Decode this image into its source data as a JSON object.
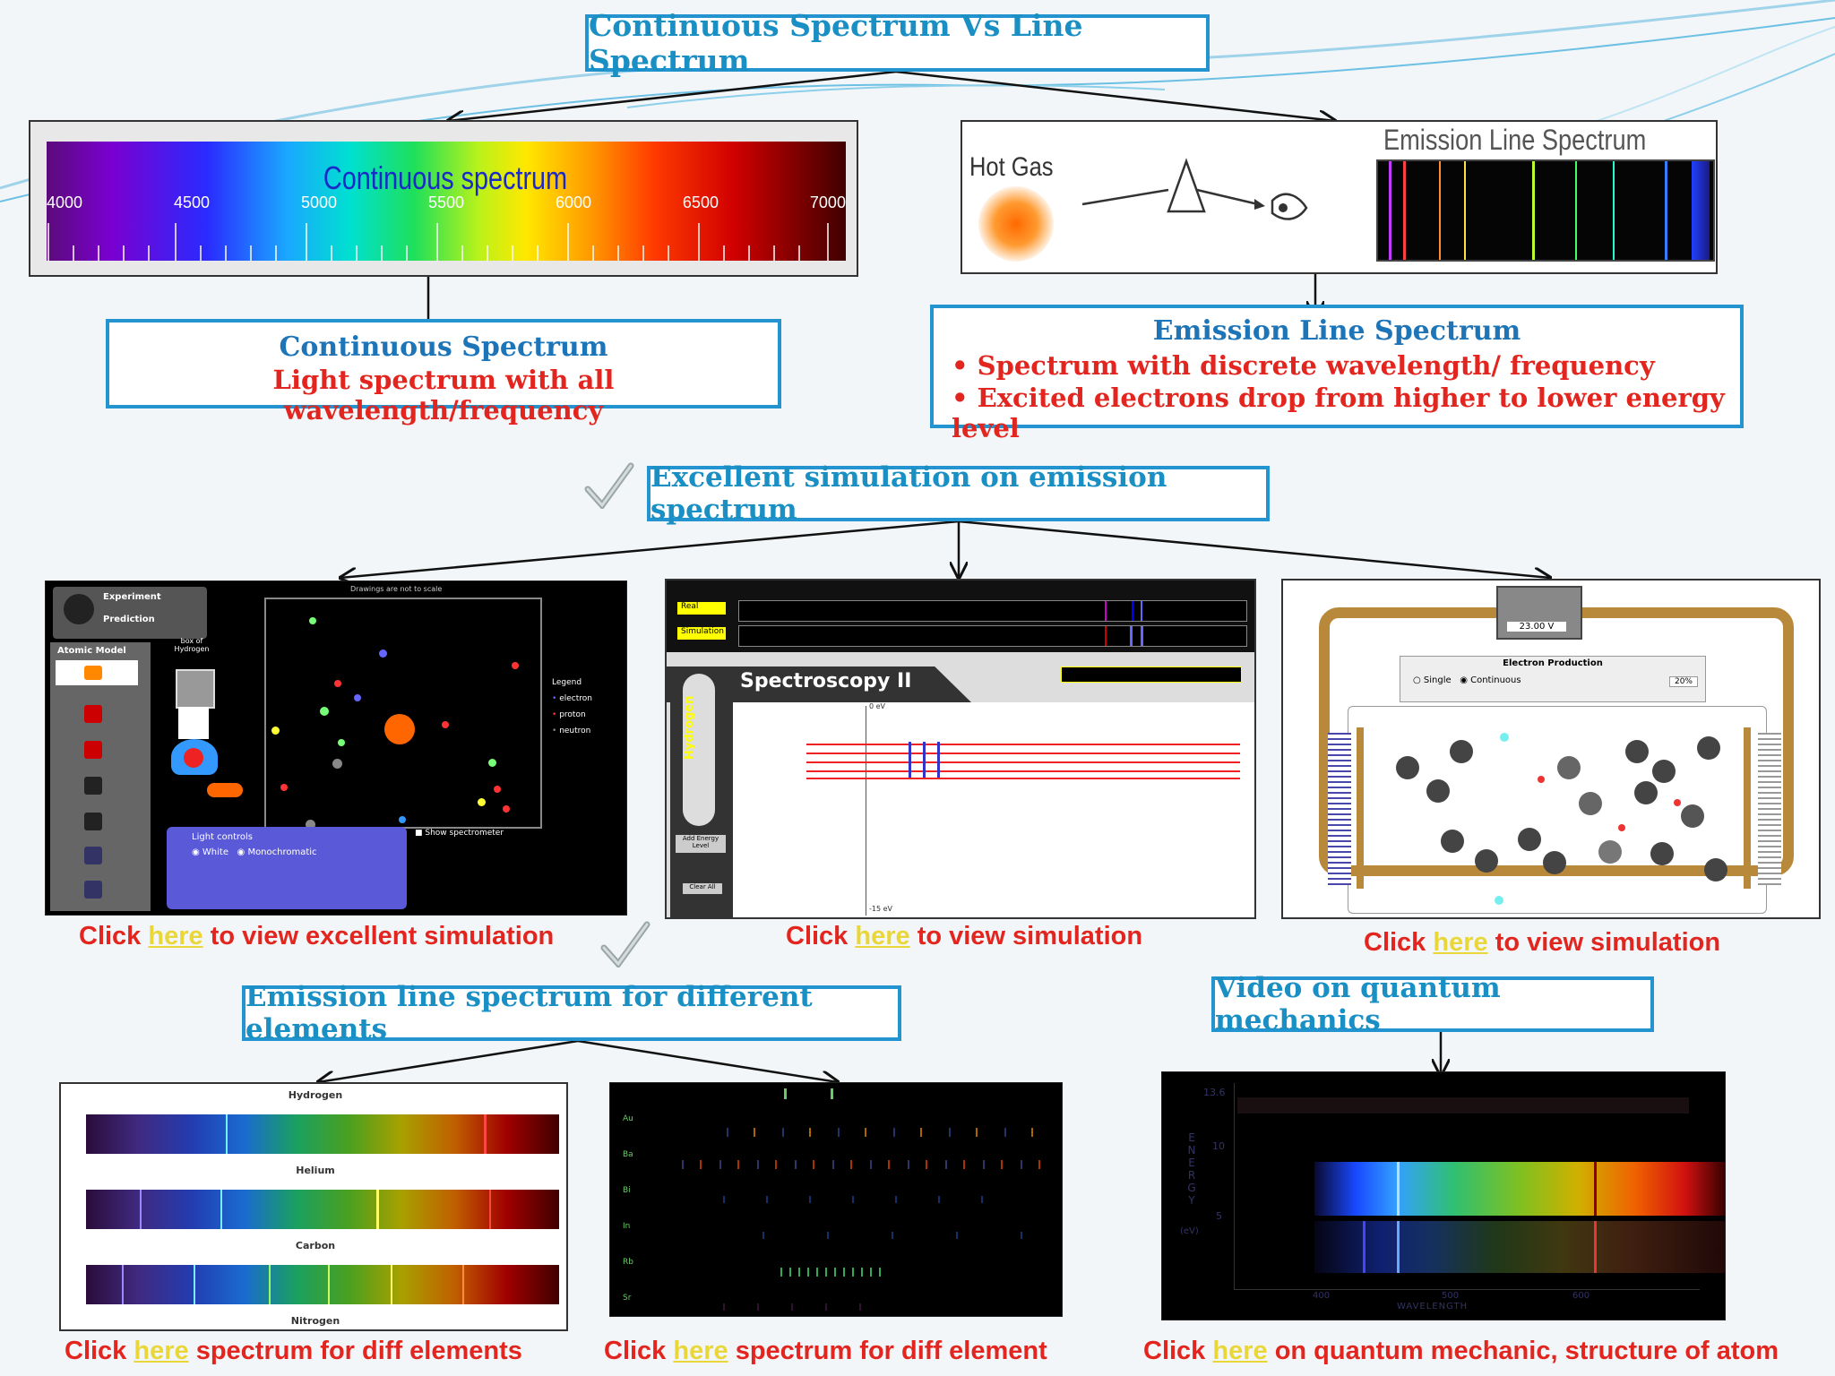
{
  "titles": {
    "main": "Continuous Spectrum Vs Line Spectrum",
    "simulation": "Excellent simulation on emission spectrum",
    "elements": "Emission line spectrum for different elements",
    "video": "Video on quantum mechanics"
  },
  "continuous_panel": {
    "label": "Continuous spectrum",
    "ticks": [
      "4000",
      "4500",
      "5000",
      "5500",
      "6000",
      "6500",
      "7000"
    ]
  },
  "emission_panel": {
    "hot_gas": "Hot Gas",
    "label": "Emission Line Spectrum"
  },
  "continuous_box": {
    "heading": "Continuous Spectrum",
    "text": "Light spectrum with all wavelength/frequency"
  },
  "emission_box": {
    "heading": "Emission Line Spectrum",
    "bullets": [
      "Spectrum with discrete wavelength/ frequency",
      "Excited electrons drop from higher to lower energy level"
    ]
  },
  "sim1": {
    "experiment": "Experiment",
    "prediction": "Prediction",
    "atomic_model": "Atomic Model",
    "box_label": "box of Hydrogen",
    "legend": "Legend",
    "legend_items": [
      "electron",
      "proton",
      "neutron"
    ],
    "light_controls": "Light controls",
    "white": "White",
    "mono": "Monochromatic",
    "show_spec": "Show spectrometer",
    "drawing_note": "Drawings are not to scale"
  },
  "sim2": {
    "title": "Spectroscopy II",
    "element": "Hydrogen",
    "add_energy": "Add Energy Level",
    "clear_all": "Clear All",
    "real": "Real",
    "simulation": "Simulation",
    "top_label": "0 eV",
    "bottom_label": "-15 eV"
  },
  "sim3": {
    "voltage": "23.00 V",
    "electron_production": "Electron Production",
    "single": "Single",
    "continuous": "Continuous",
    "percent": "20%"
  },
  "element_spectra": {
    "names": [
      "Hydrogen",
      "Helium",
      "Carbon",
      "Nitrogen"
    ]
  },
  "element_list": {
    "names": [
      "Au",
      "Ba",
      "Bi",
      "In",
      "Rb",
      "Sr"
    ]
  },
  "video_chart": {
    "energy": "ENERGY",
    "unit": "(eV)",
    "values": [
      "13.6",
      "10",
      "5"
    ],
    "x_ticks": [
      "400",
      "500",
      "600"
    ],
    "x_label": "WAVELENGTH"
  },
  "captions": {
    "sim1": {
      "pre": "Click ",
      "link": "here",
      "post": " to view excellent simulation"
    },
    "sim2": {
      "pre": "Click ",
      "link": "here",
      "post": " to view simulation"
    },
    "sim3": {
      "pre": "Click ",
      "link": "here",
      "post": " to view simulation"
    },
    "el1": {
      "pre": "Click ",
      "link": "here",
      "post": " spectrum for diff elements"
    },
    "el2": {
      "pre": "Click ",
      "link": "here",
      "post": " spectrum for diff element"
    },
    "video": {
      "pre": "Click ",
      "link": "here",
      "post": " on quantum mechanic, structure of atom"
    }
  },
  "colors": {
    "accent": "#2394cf",
    "heading_blue": "#1d75b8",
    "red": "#e2261f",
    "link_yellow": "#e9d73a"
  }
}
